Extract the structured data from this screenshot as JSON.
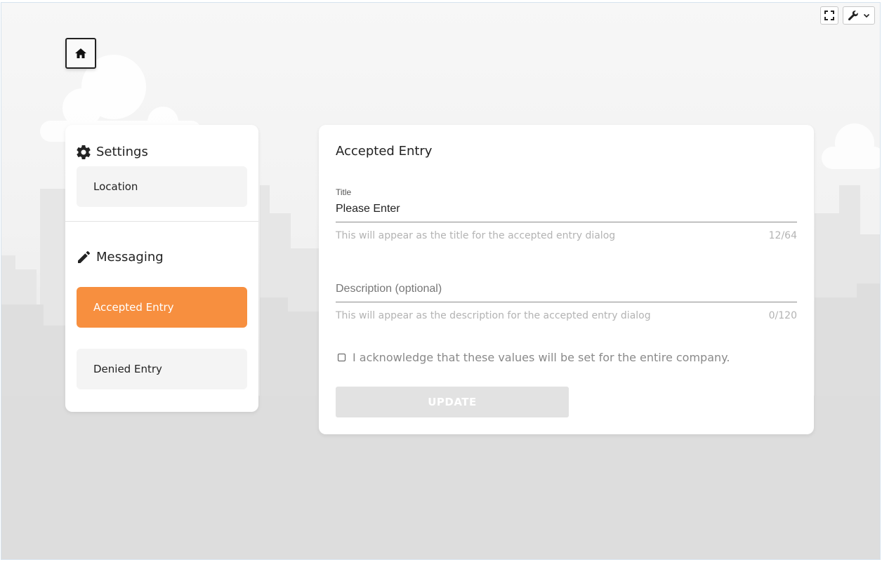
{
  "top_controls": {
    "fullscreen_icon": "fullscreen-icon",
    "tools_icon": "wrench-icon",
    "dropdown_icon": "chevron-down-icon"
  },
  "home": {
    "icon": "home-icon"
  },
  "sidebar": {
    "settings_heading": "Settings",
    "settings_icon": "gear-icon",
    "settings_items": [
      {
        "label": "Location"
      }
    ],
    "messaging_heading": "Messaging",
    "messaging_icon": "pencil-icon",
    "messaging_items": [
      {
        "label": "Accepted Entry",
        "active": true
      },
      {
        "label": "Denied Entry",
        "active": false
      }
    ]
  },
  "main": {
    "title": "Accepted Entry",
    "title_field": {
      "label": "Title",
      "value": "Please Enter",
      "helper": "This will appear as the title for the accepted entry dialog",
      "counter": "12/64"
    },
    "description_field": {
      "label": "Description (optional)",
      "value": "",
      "helper": "This will appear as the description for the accepted entry dialog",
      "counter": "0/120"
    },
    "acknowledge": {
      "text": "I acknowledge that these values will be set for the entire company.",
      "checked": false
    },
    "update_label": "UPDATE"
  },
  "colors": {
    "accent": "#f78f3f",
    "disabled_button": "#e2e2e2"
  }
}
